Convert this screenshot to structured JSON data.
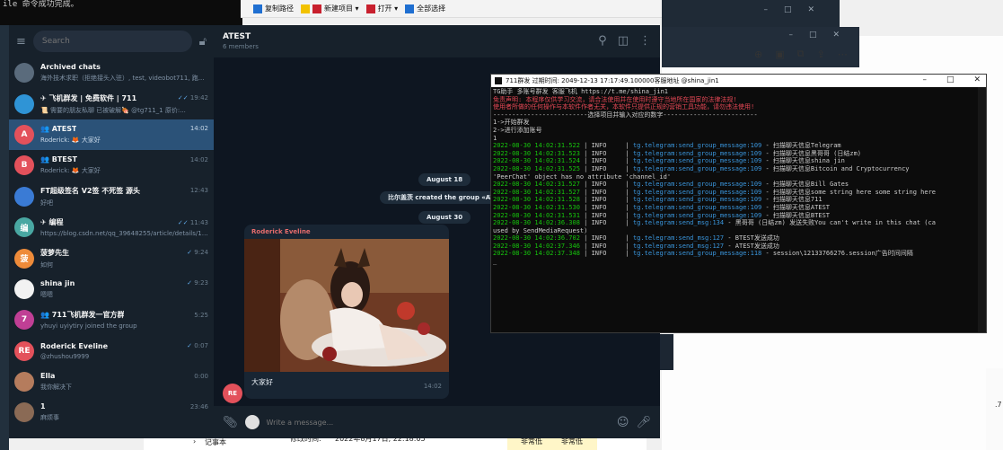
{
  "desktop": {
    "bg_cmd_lines": [
      "",
      "ile 命令成功完成。"
    ],
    "explorer_toolbar": [
      "复制路径",
      "新建项目 ▾",
      "打开 ▾",
      "全部选择"
    ],
    "file_table": {
      "folder_item": "记事本",
      "modified_label": "修改时间:",
      "modified_value": "2022年8月17日, 22:18:05",
      "col_a": "非常低",
      "col_b": "非常低"
    },
    "right_edge_text": ".7"
  },
  "telegram": {
    "search_placeholder": "Search",
    "chats": [
      {
        "name": "Archived chats",
        "msg": "海外技术求职（拒绝接头入驻）, test, videobot711, 跑...",
        "time": "",
        "avatar": "",
        "avatar_color": "#5a6b7c",
        "active": false,
        "ticks": ""
      },
      {
        "name": "✈ 飞机群发 | 免费软件 | 711",
        "msg": "📜 需要的朋友私聊 已被破解🍖 @tg711_1 原价:...",
        "time": "19:42",
        "avatar": "",
        "avatar_color": "#2f94d6",
        "active": false,
        "ticks": "✓✓"
      },
      {
        "name": "👥 ATEST",
        "msg": "Roderick: 🦊 大家好",
        "time": "14:02",
        "avatar": "A",
        "avatar_color": "#e3515b",
        "active": true,
        "ticks": ""
      },
      {
        "name": "👥 BTEST",
        "msg": "Roderick: 🦊 大家好",
        "time": "14:02",
        "avatar": "B",
        "avatar_color": "#e3515b",
        "active": false,
        "ticks": ""
      },
      {
        "name": "FT超级签名 V2签 不死签 源头",
        "msg": "好吧",
        "time": "12:43",
        "avatar": "",
        "avatar_color": "#3a7bd5",
        "active": false,
        "ticks": ""
      },
      {
        "name": "✈ 编程",
        "msg": "https://blog.csdn.net/qq_39648255/article/details/12...",
        "time": "11:43",
        "avatar": "编",
        "avatar_color": "#49a7a2",
        "active": false,
        "ticks": "✓✓"
      },
      {
        "name": "菠萝先生",
        "msg": "如何",
        "time": "9:24",
        "avatar": "菠",
        "avatar_color": "#ee8b3a",
        "active": false,
        "ticks": "✓"
      },
      {
        "name": "shina jin",
        "msg": "嗯嗯",
        "time": "9:23",
        "avatar": "",
        "avatar_color": "#f2f2f2",
        "active": false,
        "ticks": "✓"
      },
      {
        "name": "👥 711飞机群发一官方群",
        "msg": "yhuyi uyiytiry joined the group",
        "time": "5:25",
        "avatar": "7",
        "avatar_color": "#c03f95",
        "active": false,
        "ticks": ""
      },
      {
        "name": "Roderick Eveline",
        "msg": "@zhushou9999",
        "time": "0:07",
        "avatar": "RE",
        "avatar_color": "#e3515b",
        "active": false,
        "ticks": "✓"
      },
      {
        "name": "Ella",
        "msg": "我你解决下",
        "time": "0:00",
        "avatar": "",
        "avatar_color": "#b57c5d",
        "active": false,
        "ticks": ""
      },
      {
        "name": "1",
        "msg": "麻烦事",
        "time": "23:46",
        "avatar": "",
        "avatar_color": "#8a6a55",
        "active": false,
        "ticks": ""
      }
    ],
    "header": {
      "title": "ATEST",
      "subtitle": "6 members"
    },
    "service": {
      "date1": "August 18",
      "created": "比尔盖茨 created the group «ATEST»",
      "date2": "August 30"
    },
    "message": {
      "author": "Roderick Eveline",
      "text": "大家好",
      "time": "14:02",
      "avatar": "RE"
    },
    "input_placeholder": "Write a message..."
  },
  "console": {
    "title": "711群发  过期时间: 2049-12-13 17:17:49.100000客服地址 @shina_jin1",
    "lines": [
      {
        "c": "w",
        "t": "TG助手 多账号群发 客服飞机 https://t.me/shina_jin1"
      },
      {
        "c": "r",
        "t": "免责声明: 本程序仅供学习交流，请合法使用并在使用时遵守当地所在国家的法律法规!"
      },
      {
        "c": "r",
        "t": "使用者所做的任何操作与本软件作者无关，本软件只提供正规的营销工具功能，请勿违法使用!"
      },
      {
        "c": "w",
        "t": "-------------------------选择项目并输入对应的数字-------------------------"
      },
      {
        "c": "w",
        "t": "1->开始群发"
      },
      {
        "c": "w",
        "t": "2->进行添加账号"
      },
      {
        "c": "w",
        "t": "1"
      },
      {
        "c": "log",
        "ts": "2022-08-30 14:02:31.522",
        "lv": "INFO",
        "src": "tg.telegram:send_group_message:109",
        "msg": "扫描聊天信息Telegram"
      },
      {
        "c": "log",
        "ts": "2022-08-30 14:02:31.523",
        "lv": "INFO",
        "src": "tg.telegram:send_group_message:109",
        "msg": "扫描聊天信息黑哥哥 (日结zm)"
      },
      {
        "c": "log",
        "ts": "2022-08-30 14:02:31.524",
        "lv": "INFO",
        "src": "tg.telegram:send_group_message:109",
        "msg": "扫描聊天信息shina jin"
      },
      {
        "c": "log",
        "ts": "2022-08-30 14:02:31.525",
        "lv": "INFO",
        "src": "tg.telegram:send_group_message:109",
        "msg": "扫描聊天信息Bitcoin and Cryptocurrency"
      },
      {
        "c": "w",
        "t": "'PeerChat' object has no attribute 'channel_id'"
      },
      {
        "c": "log",
        "ts": "2022-08-30 14:02:31.527",
        "lv": "INFO",
        "src": "tg.telegram:send_group_message:109",
        "msg": "扫描聊天信息Bill Gates"
      },
      {
        "c": "log",
        "ts": "2022-08-30 14:02:31.527",
        "lv": "INFO",
        "src": "tg.telegram:send_group_message:109",
        "msg": "扫描聊天信息some string here some string here"
      },
      {
        "c": "log",
        "ts": "2022-08-30 14:02:31.528",
        "lv": "INFO",
        "src": "tg.telegram:send_group_message:109",
        "msg": "扫描聊天信息711"
      },
      {
        "c": "log",
        "ts": "2022-08-30 14:02:31.530",
        "lv": "INFO",
        "src": "tg.telegram:send_group_message:109",
        "msg": "扫描聊天信息ATEST"
      },
      {
        "c": "log",
        "ts": "2022-08-30 14:02:31.531",
        "lv": "INFO",
        "src": "tg.telegram:send_group_message:109",
        "msg": "扫描聊天信息BTEST"
      },
      {
        "c": "log",
        "ts": "2022-08-30 14:02:36.308",
        "lv": "INFO",
        "src": "tg.telegram:send_msg:134",
        "msg": "黑哥哥 (日结zm) 发送失败You can't write in this chat (ca"
      },
      {
        "c": "w",
        "t": "used by SendMediaRequest)"
      },
      {
        "c": "log",
        "ts": "2022-08-30 14:02:36.702",
        "lv": "INFO",
        "src": "tg.telegram:send_msg:127",
        "msg": "BTEST发送成功"
      },
      {
        "c": "log",
        "ts": "2022-08-30 14:02:37.346",
        "lv": "INFO",
        "src": "tg.telegram:send_msg:127",
        "msg": "ATEST发送成功"
      },
      {
        "c": "log",
        "ts": "2022-08-30 14:02:37.348",
        "lv": "INFO",
        "src": "tg.telegram:send_group_message:118",
        "msg": "session\\12133766276.session广告时间间隔"
      },
      {
        "c": "w",
        "t": "_"
      }
    ]
  }
}
